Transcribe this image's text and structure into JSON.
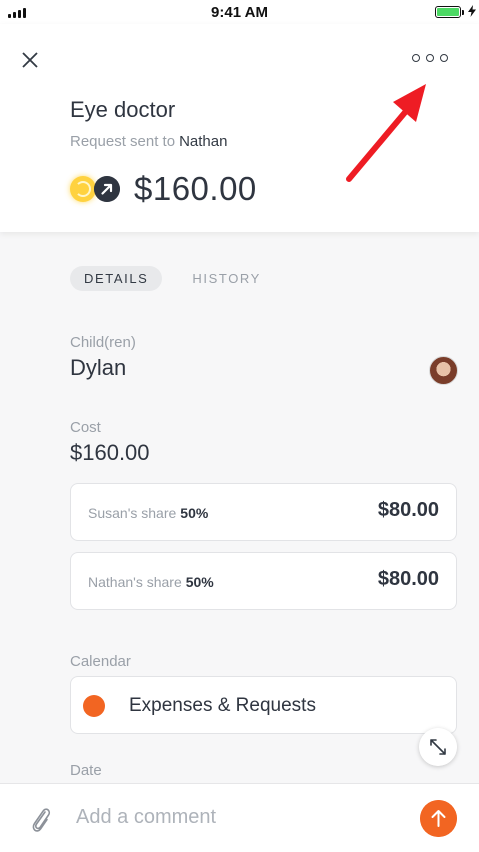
{
  "status_bar": {
    "time": "9:41 AM"
  },
  "header": {
    "title": "Eye doctor",
    "subtitle_prefix": "Request sent to",
    "recipient": "Nathan",
    "amount": "$160.00"
  },
  "tabs": [
    {
      "label": "DETAILS",
      "active": true
    },
    {
      "label": "HISTORY",
      "active": false
    }
  ],
  "details": {
    "children_label": "Child(ren)",
    "children_value": "Dylan",
    "cost_label": "Cost",
    "cost_value": "$160.00",
    "shares": [
      {
        "who": "Susan's share",
        "percent": "50%",
        "amount": "$80.00"
      },
      {
        "who": "Nathan's share",
        "percent": "50%",
        "amount": "$80.00"
      }
    ],
    "calendar_label": "Calendar",
    "calendar_name": "Expenses & Requests",
    "calendar_color": "#f26522",
    "date_label": "Date"
  },
  "comment": {
    "placeholder": "Add a comment"
  },
  "colors": {
    "accent": "#f26522",
    "coin": "#ffd23f",
    "annotation_arrow": "#ee1c24"
  },
  "icons": [
    "close-icon",
    "more-icon",
    "coin-icon",
    "arrow-up-right-icon",
    "expand-icon",
    "paperclip-icon",
    "arrow-up-icon",
    "annotation-arrow"
  ]
}
